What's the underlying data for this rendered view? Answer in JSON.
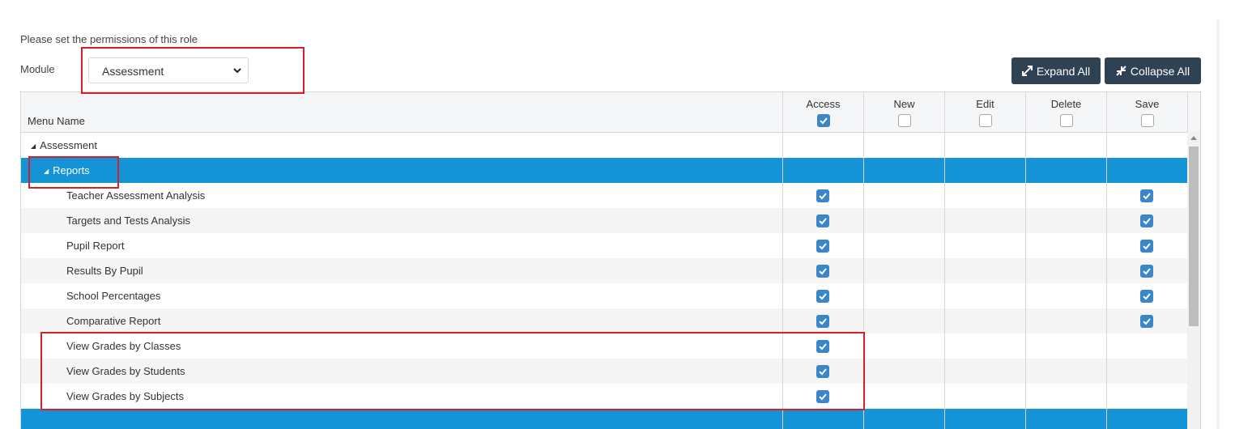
{
  "intro": "Please set the permissions of this role",
  "module": {
    "label": "Module",
    "selected": "Assessment"
  },
  "toolbar": {
    "expand_label": "Expand All",
    "collapse_label": "Collapse All"
  },
  "grid": {
    "menu_header": "Menu Name",
    "columns": [
      {
        "label": "Access",
        "header_checked": true
      },
      {
        "label": "New",
        "header_checked": false
      },
      {
        "label": "Edit",
        "header_checked": false
      },
      {
        "label": "Delete",
        "header_checked": false
      },
      {
        "label": "Save",
        "header_checked": false
      }
    ],
    "rows": [
      {
        "name": "Assessment",
        "level": 0,
        "toggle": "◢",
        "selected": false,
        "access": false,
        "new": false,
        "edit": false,
        "delete": false,
        "save": false
      },
      {
        "name": "Reports",
        "level": 1,
        "toggle": "◢",
        "selected": true,
        "access": false,
        "new": false,
        "edit": false,
        "delete": false,
        "save": false
      },
      {
        "name": "Teacher Assessment Analysis",
        "level": 2,
        "selected": false,
        "access": true,
        "new": false,
        "edit": false,
        "delete": false,
        "save": true
      },
      {
        "name": "Targets and Tests Analysis",
        "level": 2,
        "selected": false,
        "access": true,
        "new": false,
        "edit": false,
        "delete": false,
        "save": true
      },
      {
        "name": "Pupil Report",
        "level": 2,
        "selected": false,
        "access": true,
        "new": false,
        "edit": false,
        "delete": false,
        "save": true
      },
      {
        "name": "Results By Pupil",
        "level": 2,
        "selected": false,
        "access": true,
        "new": false,
        "edit": false,
        "delete": false,
        "save": true
      },
      {
        "name": "School Percentages",
        "level": 2,
        "selected": false,
        "access": true,
        "new": false,
        "edit": false,
        "delete": false,
        "save": true
      },
      {
        "name": "Comparative Report",
        "level": 2,
        "selected": false,
        "access": true,
        "new": false,
        "edit": false,
        "delete": false,
        "save": true
      },
      {
        "name": "View Grades by Classes",
        "level": 2,
        "selected": false,
        "access": true,
        "new": false,
        "edit": false,
        "delete": false,
        "save": false
      },
      {
        "name": "View Grades by Students",
        "level": 2,
        "selected": false,
        "access": true,
        "new": false,
        "edit": false,
        "delete": false,
        "save": false
      },
      {
        "name": "View Grades by Subjects",
        "level": 2,
        "selected": false,
        "access": true,
        "new": false,
        "edit": false,
        "delete": false,
        "save": false
      },
      {
        "name": "",
        "level": 1,
        "selected": true,
        "access": false,
        "new": false,
        "edit": false,
        "delete": false,
        "save": false
      }
    ]
  },
  "colors": {
    "accent": "#1494d7",
    "checkbox": "#3b86c8",
    "button": "#2f4254",
    "highlight": "#d8202a"
  }
}
